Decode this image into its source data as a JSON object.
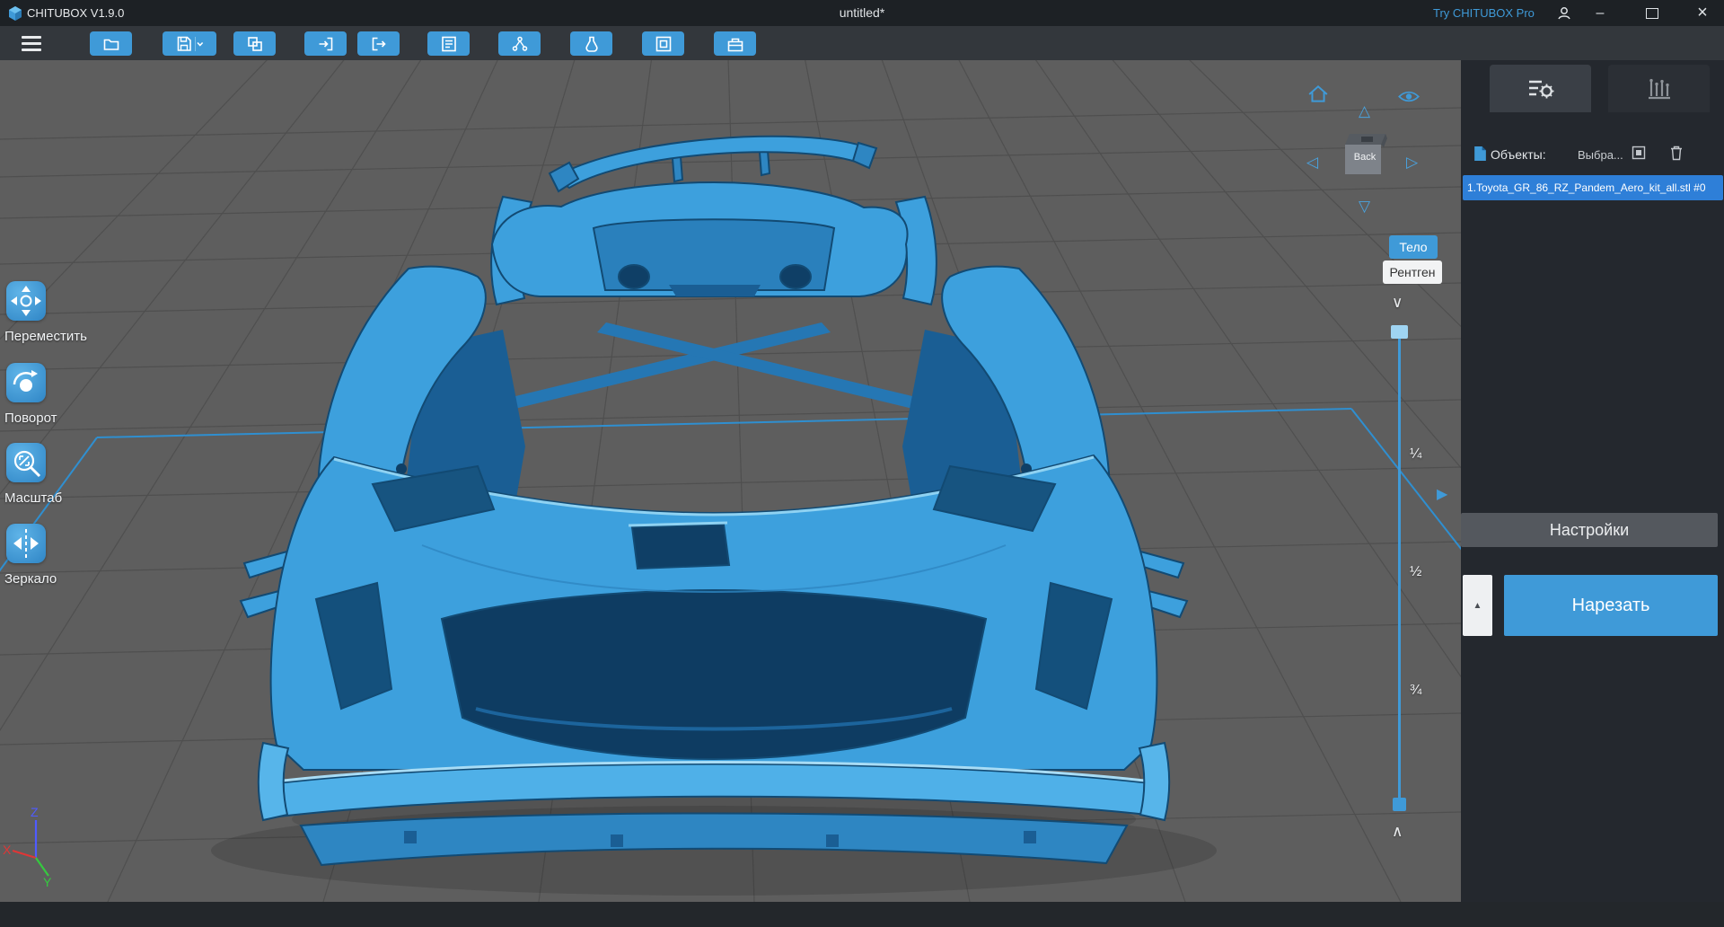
{
  "titlebar": {
    "app_title": "CHITUBOX V1.9.0",
    "doc_title": "untitled*",
    "pro_link": "Try CHITUBOX Pro"
  },
  "toolbar": {
    "buttons": [
      {
        "icon": "folder-icon"
      },
      {
        "icon": "save-icon"
      },
      {
        "icon": "clone-icon"
      },
      {
        "icon": "arrow-in-icon"
      },
      {
        "icon": "arrow-out-icon"
      },
      {
        "icon": "list-icon"
      },
      {
        "icon": "network-icon"
      },
      {
        "icon": "flask-icon"
      },
      {
        "icon": "frame-icon"
      },
      {
        "icon": "box-icon"
      }
    ]
  },
  "left_tools": {
    "items": [
      {
        "label": "Переместить",
        "icon": "move-icon"
      },
      {
        "label": "Поворот",
        "icon": "rotate-icon"
      },
      {
        "label": "Масштаб",
        "icon": "scale-icon"
      },
      {
        "label": "Зеркало",
        "icon": "mirror-icon"
      }
    ]
  },
  "viewport": {
    "view_cube": {
      "front_label": "Back"
    },
    "display_mode": {
      "body": "Тело",
      "xray": "Рентген"
    },
    "clip_slider": {
      "quarter": "¼",
      "half": "½",
      "three_quarter": "¾"
    },
    "axis": {
      "x": "X",
      "y": "Y",
      "z": "Z"
    }
  },
  "right_panel": {
    "tabs": [
      {
        "icon": "settings-tab-icon",
        "active": true
      },
      {
        "icon": "support-tab-icon",
        "active": false
      }
    ],
    "objects_label": "Объекты:",
    "selection_label": "Выбра...",
    "object_item": {
      "name": "1.Toyota_GR_86_RZ_Pandem_Aero_kit_all.stl #0"
    },
    "settings_button": "Настройки",
    "slice_button": "Нарезать"
  },
  "icons": {
    "nav_up": "△",
    "nav_down": "▽",
    "nav_left": "◁",
    "nav_right": "▷",
    "slider_caret_top": "∨",
    "slider_caret_bottom": "∧",
    "expand_right": "▶",
    "slice_toggle": "▲",
    "minimize_glyph": "–",
    "close_glyph": "×"
  },
  "colors": {
    "accent": "#3f9ad8",
    "selection": "#2e7fd8",
    "viewport_bg": "#5e5e5e",
    "panel_bg": "#24282e"
  }
}
